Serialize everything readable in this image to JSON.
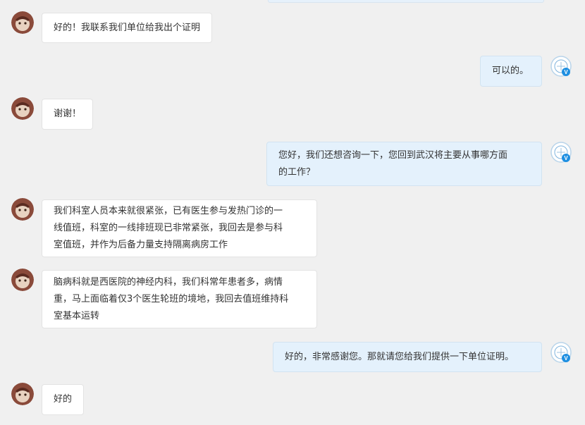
{
  "messages": [
    {
      "side": "left",
      "text": "好的！我联系我们单位给我出个证明"
    },
    {
      "side": "right",
      "text": "可以的。"
    },
    {
      "side": "left",
      "text": "谢谢！"
    },
    {
      "side": "right",
      "text": "您好，我们还想咨询一下，您回到武汉将主要从事哪方面\n的工作？"
    },
    {
      "side": "left",
      "text": "我们科室人员本来就很紧张，已有医生参与发热门诊的一\n线值班，科室的一线排班现已非常紧张，我回去是参与科\n室值班，并作为后备力量支持隔离病房工作"
    },
    {
      "side": "left",
      "text": "脑病科就是西医院的神经内科，我们科常年患者多，病情\n重，马上面临着仅3个医生轮班的境地，我回去值班维持科\n室基本运转"
    },
    {
      "side": "right",
      "text": "好的，非常感谢您。那就请您给我们提供一下单位证明。"
    },
    {
      "side": "left",
      "text": "好的"
    }
  ],
  "avatars": {
    "left_icon": "user-photo-avatar-icon",
    "right_icon": "verified-official-avatar-icon",
    "verified_badge": "V"
  },
  "colors": {
    "page_bg": "#f0f0f0",
    "left_bubble_bg": "#ffffff",
    "right_bubble_bg": "#e4f1fc",
    "verified_badge": "#1e8fe1"
  }
}
